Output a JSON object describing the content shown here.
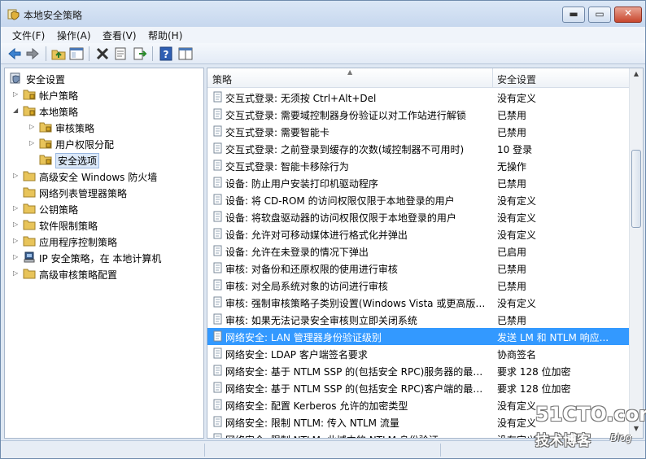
{
  "window": {
    "title": "本地安全策略"
  },
  "titlebar_buttons": {
    "minimize": "▬",
    "maximize": "▭",
    "close": "✕"
  },
  "menu": [
    "文件(F)",
    "操作(A)",
    "查看(V)",
    "帮助(H)"
  ],
  "toolbar": [
    "back-icon",
    "forward-icon",
    "up-folder-icon",
    "show-tree-icon",
    "delete-icon",
    "properties-icon",
    "export-icon",
    "help-icon",
    "panel-icon"
  ],
  "tree": [
    {
      "label": "安全设置",
      "expander": "",
      "icon": "shield"
    },
    {
      "label": "帐户策略",
      "expander": "▷",
      "icon": "folder"
    },
    {
      "label": "本地策略",
      "expander": "◢",
      "icon": "folder"
    },
    {
      "label": "审核策略",
      "expander": "▷",
      "icon": "folder"
    },
    {
      "label": "用户权限分配",
      "expander": "▷",
      "icon": "folder"
    },
    {
      "label": "安全选项",
      "expander": "",
      "icon": "folder",
      "selected": true
    },
    {
      "label": "高级安全 Windows 防火墙",
      "expander": "▷",
      "icon": "folder"
    },
    {
      "label": "网络列表管理器策略",
      "expander": "",
      "icon": "folder"
    },
    {
      "label": "公钥策略",
      "expander": "▷",
      "icon": "folder"
    },
    {
      "label": "软件限制策略",
      "expander": "▷",
      "icon": "folder"
    },
    {
      "label": "应用程序控制策略",
      "expander": "▷",
      "icon": "folder"
    },
    {
      "label": "IP 安全策略，在 本地计算机",
      "expander": "▷",
      "icon": "computer"
    },
    {
      "label": "高级审核策略配置",
      "expander": "▷",
      "icon": "folder"
    }
  ],
  "list": {
    "columns": [
      "策略",
      "安全设置"
    ],
    "sort_indicator": "▲",
    "rows": [
      {
        "policy": "交互式登录: 无须按 Ctrl+Alt+Del",
        "setting": "没有定义"
      },
      {
        "policy": "交互式登录: 需要域控制器身份验证以对工作站进行解锁",
        "setting": "已禁用"
      },
      {
        "policy": "交互式登录: 需要智能卡",
        "setting": "已禁用"
      },
      {
        "policy": "交互式登录: 之前登录到缓存的次数(域控制器不可用时)",
        "setting": "10 登录"
      },
      {
        "policy": "交互式登录: 智能卡移除行为",
        "setting": "无操作"
      },
      {
        "policy": "设备: 防止用户安装打印机驱动程序",
        "setting": "已禁用"
      },
      {
        "policy": "设备: 将 CD-ROM 的访问权限仅限于本地登录的用户",
        "setting": "没有定义"
      },
      {
        "policy": "设备: 将软盘驱动器的访问权限仅限于本地登录的用户",
        "setting": "没有定义"
      },
      {
        "policy": "设备: 允许对可移动媒体进行格式化并弹出",
        "setting": "没有定义"
      },
      {
        "policy": "设备: 允许在未登录的情况下弹出",
        "setting": "已启用"
      },
      {
        "policy": "审核: 对备份和还原权限的使用进行审核",
        "setting": "已禁用"
      },
      {
        "policy": "审核: 对全局系统对象的访问进行审核",
        "setting": "已禁用"
      },
      {
        "policy": "审核: 强制审核策略子类别设置(Windows Vista 或更高版本...",
        "setting": "没有定义"
      },
      {
        "policy": "审核: 如果无法记录安全审核则立即关闭系统",
        "setting": "已禁用"
      },
      {
        "policy": "网络安全: LAN 管理器身份验证级别",
        "setting": "发送 LM 和 NTLM 响应...",
        "selected": true
      },
      {
        "policy": "网络安全: LDAP 客户端签名要求",
        "setting": "协商签名"
      },
      {
        "policy": "网络安全: 基于 NTLM SSP 的(包括安全 RPC)服务器的最小...",
        "setting": "要求 128 位加密"
      },
      {
        "policy": "网络安全: 基于 NTLM SSP 的(包括安全 RPC)客户端的最小...",
        "setting": "要求 128 位加密"
      },
      {
        "policy": "网络安全: 配置 Kerberos 允许的加密类型",
        "setting": "没有定义"
      },
      {
        "policy": "网络安全: 限制 NTLM: 传入 NTLM 流量",
        "setting": "没有定义"
      },
      {
        "policy": "网络安全: 限制 NTLM: 此域中的 NTLM 身份验证",
        "setting": "没有定义"
      }
    ]
  },
  "scrollbar": {
    "up": "▲",
    "down": "▼"
  },
  "watermark": {
    "main": "51CTO.com",
    "sub": "技术博客",
    "blog": "Blog"
  },
  "colors": {
    "selection": "#3399ff",
    "folder": "#e8c45a"
  }
}
